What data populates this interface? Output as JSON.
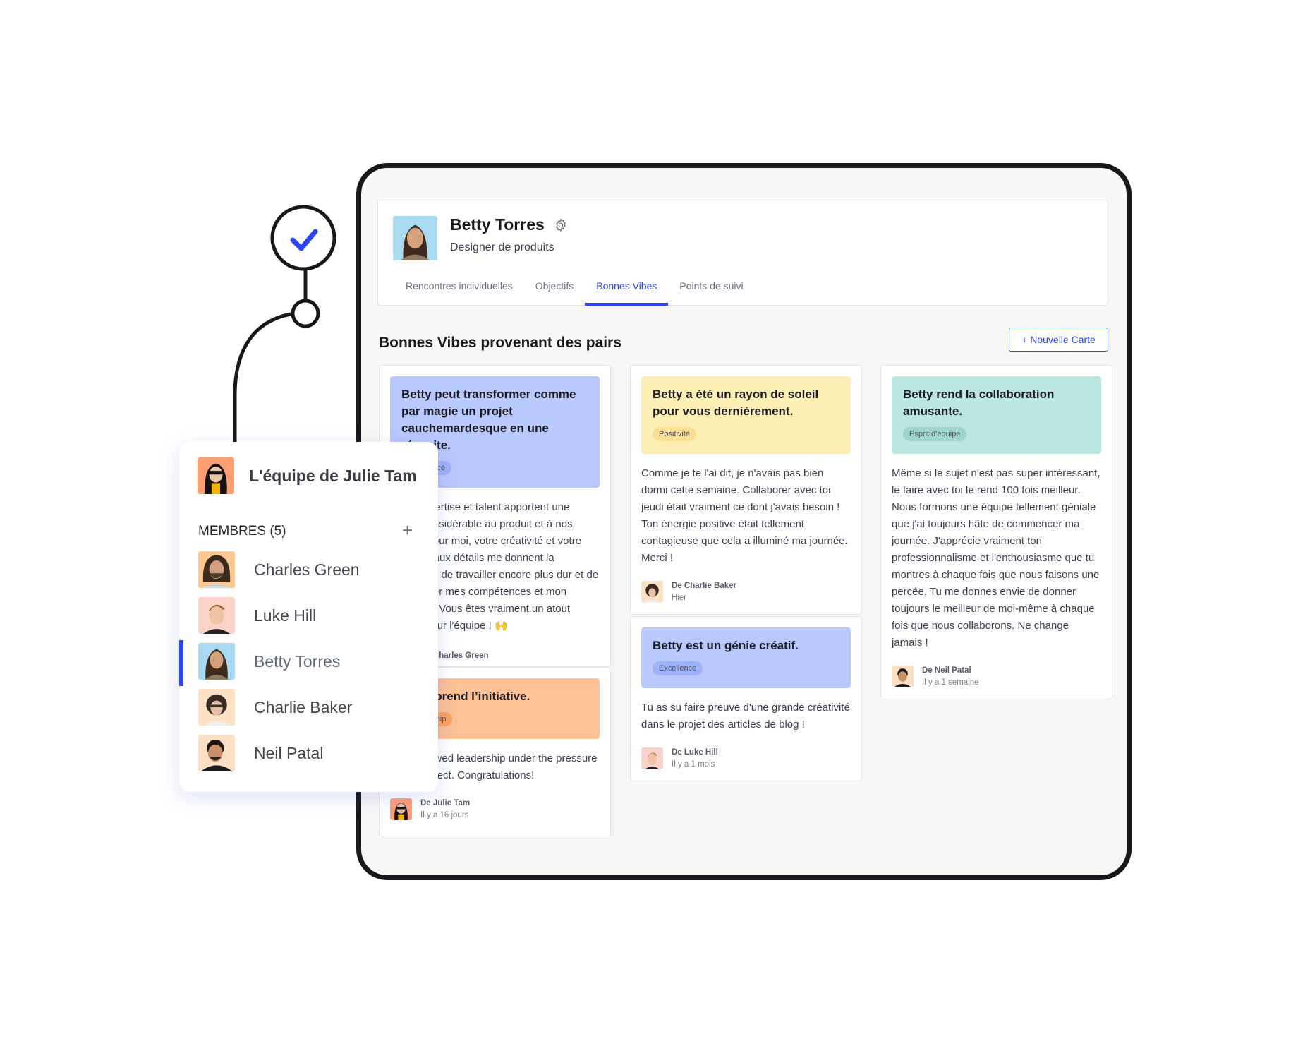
{
  "profile": {
    "name": "Betty Torres",
    "role": "Designer de produits",
    "settings_icon": "gear-icon"
  },
  "tabs": [
    {
      "label": "Rencontres individuelles",
      "active": false
    },
    {
      "label": "Objectifs",
      "active": false
    },
    {
      "label": "Bonnes Vibes",
      "active": true
    },
    {
      "label": "Points de suivi",
      "active": false
    }
  ],
  "section": {
    "title": "Bonnes Vibes provenant des pairs",
    "new_card_button": "+ Nouvelle Carte"
  },
  "colors": {
    "accent": "#2b47f2",
    "blue_banner": "#b9c8fd",
    "yellow_banner": "#fdeeb3",
    "teal_banner": "#bbe6df",
    "orange_banner": "#fdc195",
    "frame": "#18171c",
    "background": "#f8f7f5"
  },
  "cards": [
    {
      "title": "Betty peut transformer comme par magie un projet cauchemardesque en une réussite.",
      "tag": "Excellence",
      "body": "Votre expertise et talent apportent une valeur considérable au produit et à nos clients. Pour moi, votre créativité et votre attention aux détails me donnent la motivation de travailler encore plus dur et de développer mes compétences et mon expertise. Vous êtes vraiment un atout majeur pour l'équipe ! 🙌",
      "from": "De Charles Green",
      "time": "",
      "color": "blue"
    },
    {
      "title": "Betty prend l’initiative.",
      "tag": "Leadership",
      "body": "Betty showed leadership under the pressure of the project. Congratulations!",
      "from": "De Julie Tam",
      "time": "Il y a 16 jours",
      "color": "orange"
    },
    {
      "title": "Betty a été un rayon de soleil pour vous dernièrement.",
      "tag": "Positivité",
      "body": "Comme je te l'ai dit, je n'avais pas bien dormi cette semaine. Collaborer avec toi jeudi était vraiment ce dont j'avais besoin ! Ton énergie positive était tellement contagieuse que cela a illuminé ma journée. Merci !",
      "from": "De Charlie Baker",
      "time": "Hier",
      "color": "yellow"
    },
    {
      "title": "Betty est un génie créatif.",
      "tag": "Excellence",
      "body": "Tu as su faire preuve d'une grande créativité dans le projet des articles de blog !",
      "from": "De Luke Hill",
      "time": "Il y a 1 mois",
      "color": "blue"
    },
    {
      "title": "Betty rend la collaboration amusante.",
      "tag": "Esprit d'équipe",
      "body": "Même si le sujet n'est pas super intéressant, le faire avec toi le rend 100 fois meilleur. Nous formons une équipe tellement géniale que j'ai toujours hâte de commencer ma journée. J'apprécie vraiment ton professionnalisme et l'enthousiasme que tu montres à chaque fois que nous faisons une percée. Tu me donnes envie de donner toujours le meilleur de moi-même à chaque fois que nous collaborons. Ne change jamais !",
      "from": "De Neil Patal",
      "time": "Il y a 1 semaine",
      "color": "teal"
    }
  ],
  "team": {
    "title": "L'équipe de Julie Tam",
    "members_label": "MEMBRES (5)",
    "add_icon": "plus-icon",
    "members": [
      {
        "name": "Charles Green",
        "active": false
      },
      {
        "name": "Luke Hill",
        "active": false
      },
      {
        "name": "Betty Torres",
        "active": true
      },
      {
        "name": "Charlie Baker",
        "active": false
      },
      {
        "name": "Neil Patal",
        "active": false
      }
    ]
  },
  "decoration": {
    "check_icon": "checkmark-icon"
  }
}
